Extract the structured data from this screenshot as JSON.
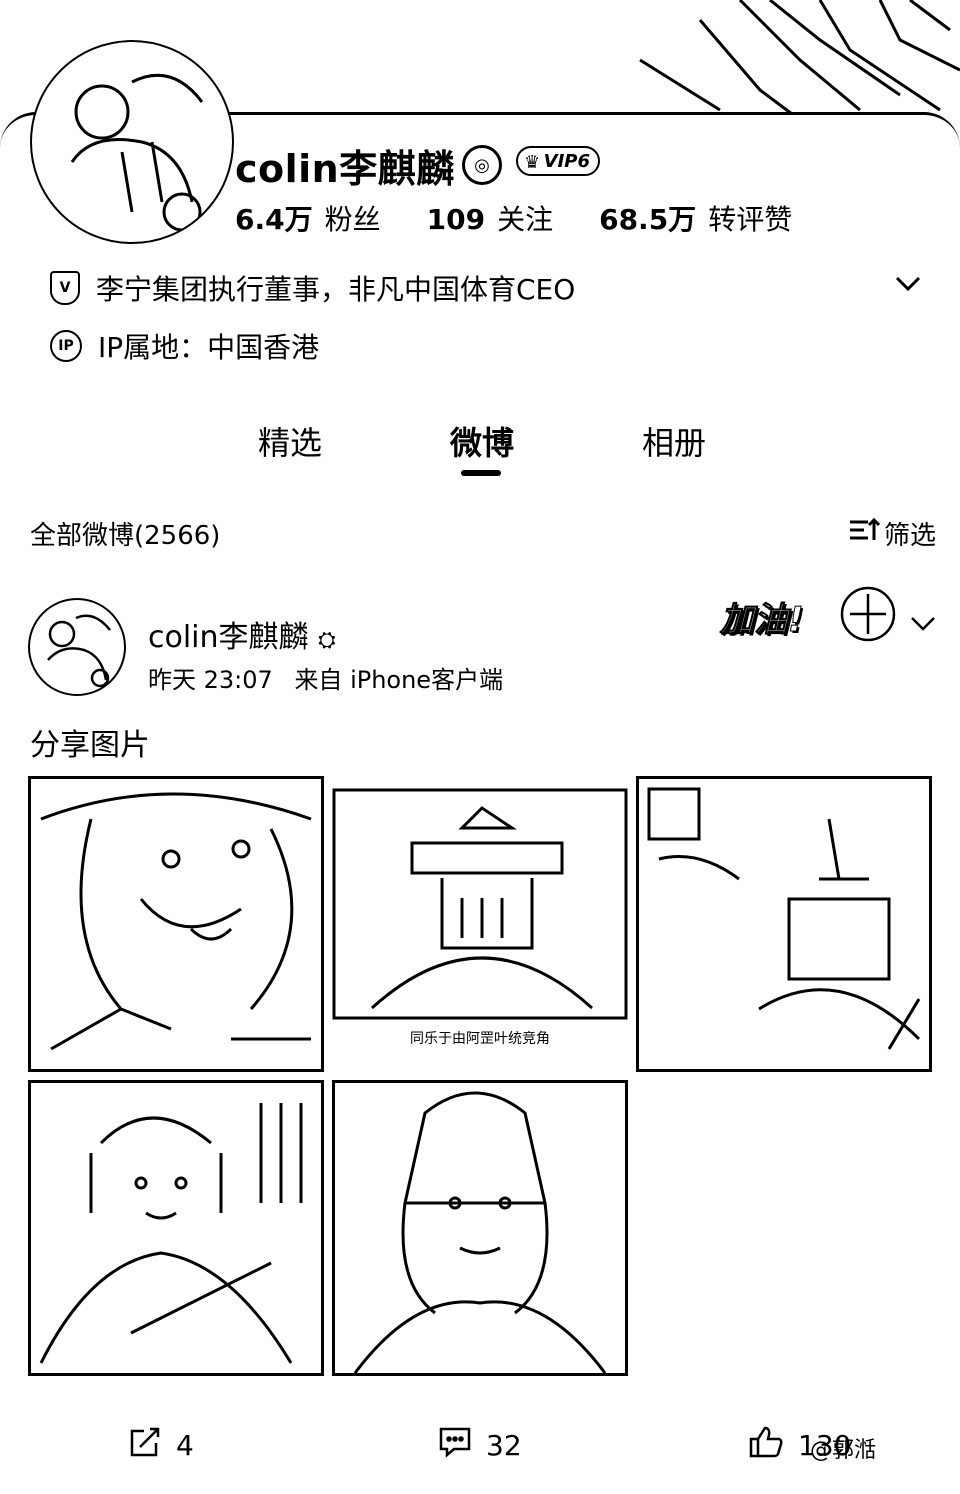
{
  "profile": {
    "name": "colin李麒麟",
    "vip_label": "VIP6",
    "stats": [
      {
        "value": "6.4万",
        "label": "粉丝"
      },
      {
        "value": "109",
        "label": "关注"
      },
      {
        "value": "68.5万",
        "label": "转评赞"
      }
    ],
    "verified_text": "李宁集团执行董事，非凡中国体育CEO",
    "ip_label": "IP属地：中国香港",
    "verified_icon_letter": "V",
    "ip_icon_letter": "IP"
  },
  "tabs": [
    "精选",
    "微博",
    "相册"
  ],
  "active_tab": "微博",
  "feed": {
    "section_title": "全部微博(2566)",
    "filter_label": "筛选"
  },
  "post": {
    "author": "colin李麒麟",
    "time": "昨天 23:07",
    "source": "来自 iPhone客户端",
    "text": "分享图片",
    "sticker_text": "加油!",
    "image3_caption": "同乐于由阿罡叶统竞角",
    "actions": [
      {
        "icon": "repost-icon",
        "count": "4"
      },
      {
        "icon": "comment-icon",
        "count": "32"
      },
      {
        "icon": "like-icon",
        "count": "130"
      }
    ]
  },
  "watermark": "@郭湉"
}
